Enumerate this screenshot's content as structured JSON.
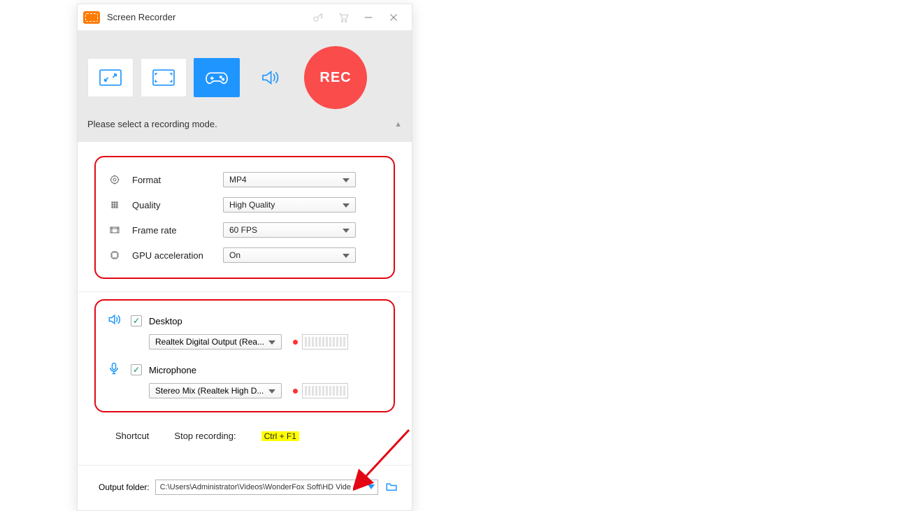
{
  "titlebar": {
    "title": "Screen Recorder"
  },
  "modes": {
    "prompt": "Please select a recording mode.",
    "rec_label": "REC"
  },
  "settings": {
    "format": {
      "label": "Format",
      "value": "MP4"
    },
    "quality": {
      "label": "Quality",
      "value": "High Quality"
    },
    "framerate": {
      "label": "Frame rate",
      "value": "60 FPS"
    },
    "gpu": {
      "label": "GPU acceleration",
      "value": "On"
    }
  },
  "audio": {
    "desktop": {
      "label": "Desktop",
      "device": "Realtek Digital Output (Rea...",
      "checked": true
    },
    "microphone": {
      "label": "Microphone",
      "device": "Stereo Mix (Realtek High D...",
      "checked": true
    }
  },
  "shortcut": {
    "label": "Shortcut",
    "action": "Stop recording:",
    "key": "Ctrl + F1"
  },
  "footer": {
    "label": "Output folder:",
    "path": "C:\\Users\\Administrator\\Videos\\WonderFox Soft\\HD Vide"
  }
}
